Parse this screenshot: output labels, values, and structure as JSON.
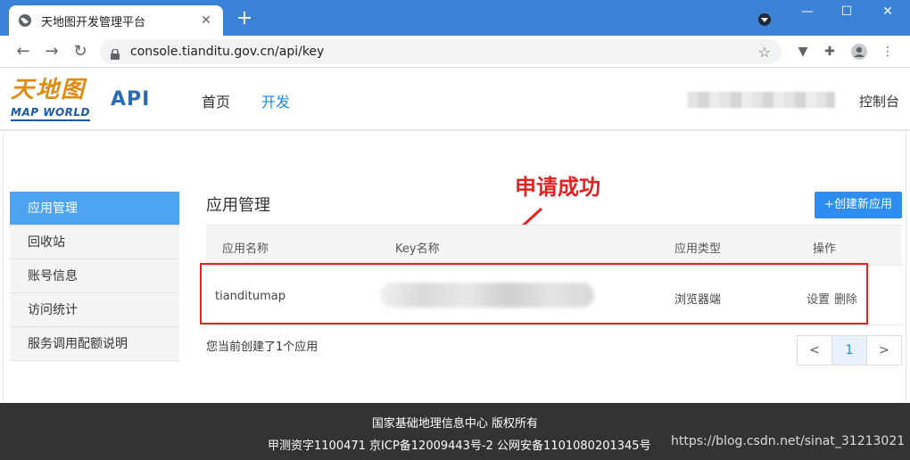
{
  "browser": {
    "tab_title": "天地图开发管理平台",
    "tab_close": "✕",
    "new_tab": "+",
    "url": "console.tianditu.gov.cn/api/key",
    "window_minimize": "—",
    "window_maximize": "☐",
    "window_close": "✕"
  },
  "site": {
    "logo_cn": "天地图",
    "logo_en": "MAP WORLD",
    "api_label": "API",
    "nav": [
      {
        "label": "首页"
      },
      {
        "label": "开发"
      }
    ],
    "console_label": "控制台"
  },
  "sidebar": {
    "items": [
      {
        "label": "应用管理"
      },
      {
        "label": "回收站"
      },
      {
        "label": "账号信息"
      },
      {
        "label": "访问统计"
      },
      {
        "label": "服务调用配额说明"
      }
    ]
  },
  "main": {
    "title": "应用管理",
    "create_button": "+创建新应用",
    "annotation": "申请成功",
    "columns": [
      "应用名称",
      "Key名称",
      "应用类型",
      "操作"
    ],
    "rows": [
      {
        "name": "tianditumap",
        "type": "浏览器端",
        "actions": [
          "设置",
          "删除"
        ]
      }
    ],
    "summary": "您当前创建了1个应用",
    "pager": {
      "prev": "<",
      "current": "1",
      "next": ">"
    }
  },
  "footer": {
    "line1": "国家基础地理信息中心  版权所有",
    "line2": "甲测资字1100471  京ICP备12009443号-2  公网安备1101080201345号",
    "watermark": "https://blog.csdn.net/sinat_31213021"
  },
  "colors": {
    "tabbar": "#3b82d6",
    "accent": "#2e8ef0",
    "annotation": "#e42222",
    "footer": "#333333"
  }
}
